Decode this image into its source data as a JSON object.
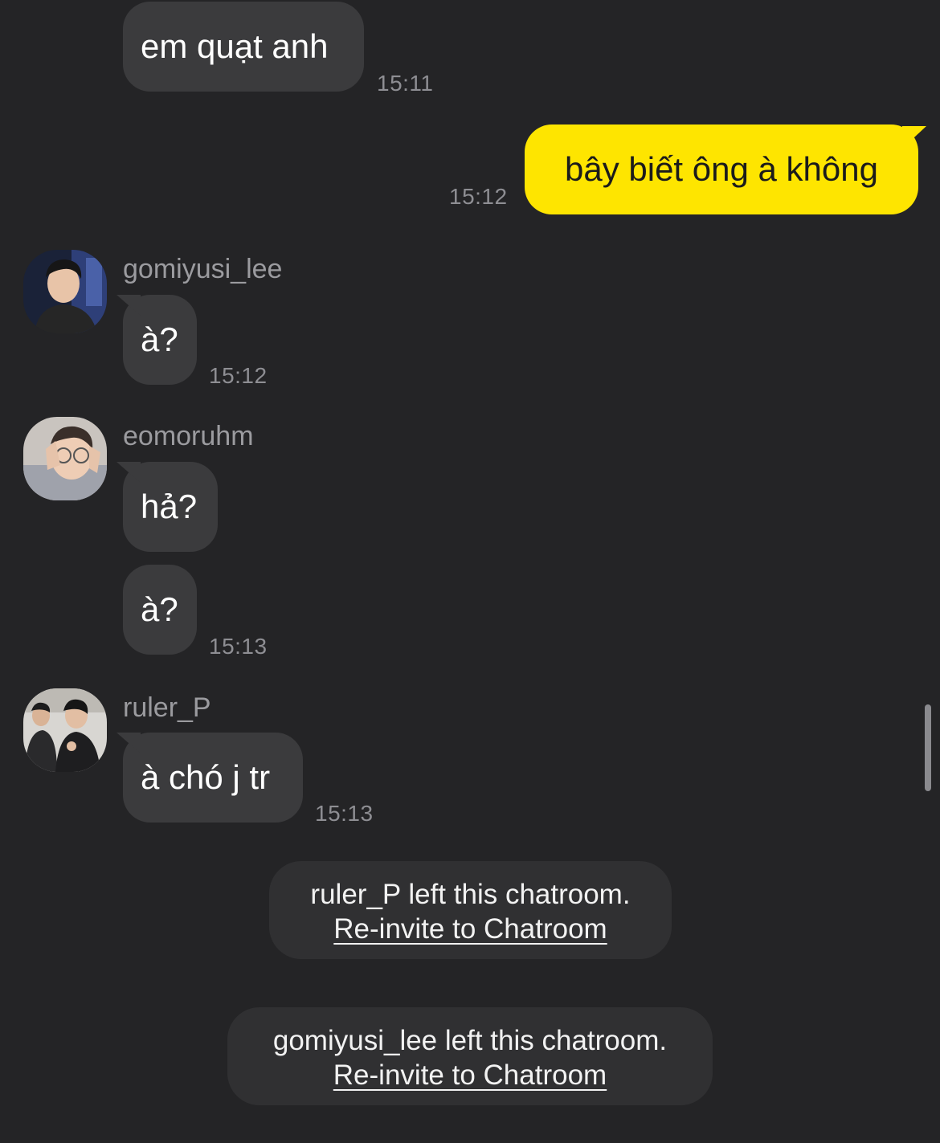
{
  "theme": {
    "background": "#242426",
    "incoming_bubble": "#3b3b3d",
    "outgoing_bubble": "#fee500",
    "notice_bubble": "#303032",
    "timestamp_color": "#8e8e93"
  },
  "messages": [
    {
      "text": "em quạt anh",
      "time": "15:11"
    },
    {
      "text": "bây biết ông à không",
      "time": "15:12",
      "outgoing": true
    },
    {
      "sender": "gomiyusi_lee",
      "avatar_icon": "user-photo-icon",
      "text": "à?",
      "time": "15:12"
    },
    {
      "sender": "eomoruhm",
      "avatar_icon": "user-photo-icon",
      "text": "hả?"
    },
    {
      "text": "à?",
      "time": "15:13"
    },
    {
      "sender": "ruler_P",
      "avatar_icon": "user-photo-icon",
      "text": "à chó j tr",
      "time": "15:13"
    }
  ],
  "notices": [
    {
      "text": "ruler_P left this chatroom.",
      "link": "Re-invite to Chatroom"
    },
    {
      "text": "gomiyusi_lee left this chatroom.",
      "link": "Re-invite to Chatroom"
    }
  ]
}
